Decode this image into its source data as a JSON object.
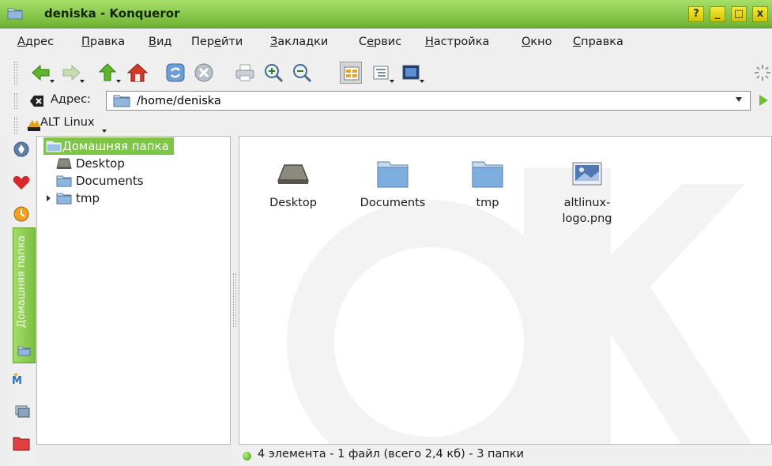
{
  "window": {
    "title": "deniska - Konqueror",
    "help_label": "?",
    "minimize_label": "_",
    "maximize_label": "□",
    "close_label": "x"
  },
  "menu": [
    {
      "label": "Адрес",
      "underline_index": 0
    },
    {
      "label": "Правка",
      "underline_index": 0
    },
    {
      "label": "Вид",
      "underline_index": 0
    },
    {
      "label": "Перейти",
      "underline_index": 3
    },
    {
      "label": "Закладки",
      "underline_index": 0
    },
    {
      "label": "Сервис",
      "underline_index": 1
    },
    {
      "label": "Настройка",
      "underline_index": 0
    },
    {
      "label": "Окно",
      "underline_index": 0
    },
    {
      "label": "Справка",
      "underline_index": 0
    }
  ],
  "toolbar": {
    "icons": [
      "back-icon",
      "forward-icon",
      "up-icon",
      "home-icon",
      "reload-icon",
      "stop-icon",
      "print-icon",
      "zoom-in-icon",
      "zoom-out-icon",
      "icon-view-icon",
      "tree-view-icon",
      "preview-icon"
    ]
  },
  "location": {
    "label": "Адрес:",
    "value": "/home/deniska"
  },
  "bookmarks": {
    "item": "ALT Linux"
  },
  "sidebar": {
    "home_tab_label": "Домашняя папка"
  },
  "tree": {
    "items": [
      {
        "label": "Домашняя папка",
        "selected": true
      },
      {
        "label": "Desktop"
      },
      {
        "label": "Documents"
      },
      {
        "label": "tmp",
        "expandable": true
      }
    ]
  },
  "files": [
    {
      "name": "Desktop",
      "icon": "desktop-folder-icon"
    },
    {
      "name": "Documents",
      "icon": "folder-icon"
    },
    {
      "name": "tmp",
      "icon": "folder-icon"
    },
    {
      "name": "altlinux-logo.png",
      "line1": "altlinux-",
      "line2": "logo.png",
      "icon": "image-file-icon"
    }
  ],
  "status": {
    "text": "4 элемента - 1 файл (всего 2,4 кб) - 3 папки"
  },
  "colors": {
    "titlebar": "#8ccb4e",
    "selection": "#7cc545",
    "window_buttons": "#e8d81a"
  }
}
